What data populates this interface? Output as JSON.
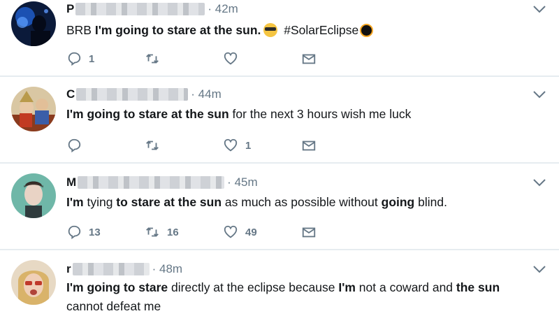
{
  "tweets": [
    {
      "name_initial": "P",
      "time": "42m",
      "reply_count": "1",
      "retweet_count": "",
      "like_count": "",
      "text_parts": {
        "a": "BRB ",
        "b_bold": "I'm going to stare at the sun.",
        "c": " #SolarEclipse"
      },
      "emoji_1": "sunglasses-emoji",
      "emoji_2": "eclipse-emoji"
    },
    {
      "name_initial": "C",
      "time": "44m",
      "reply_count": "",
      "retweet_count": "",
      "like_count": "1",
      "text_parts": {
        "b_bold": "I'm going to stare at the sun",
        "c": " for the next 3 hours wish me luck"
      }
    },
    {
      "name_initial": "M",
      "time": "45m",
      "reply_count": "13",
      "retweet_count": "16",
      "like_count": "49",
      "text_parts": {
        "b1_bold": "I'm",
        "a": " tying ",
        "b2_bold": "to stare at the sun",
        "c": " as much as possible without ",
        "b3_bold": "going",
        "d": " blind."
      }
    },
    {
      "name_initial": "r",
      "time": "48m",
      "text_parts": {
        "b1_bold": "I'm going to stare",
        "a": " directly at the eclipse because ",
        "b2_bold": "I'm",
        "c": " not a coward and ",
        "b3_bold": "the sun",
        "d": "cannot defeat me"
      }
    }
  ],
  "icons": {
    "reply": "reply-icon",
    "retweet": "retweet-icon",
    "like": "heart-icon",
    "dm": "envelope-icon",
    "menu": "chevron-down-icon"
  },
  "colors": {
    "text": "#14171a",
    "muted": "#657786",
    "divider": "#e6ecf0"
  }
}
